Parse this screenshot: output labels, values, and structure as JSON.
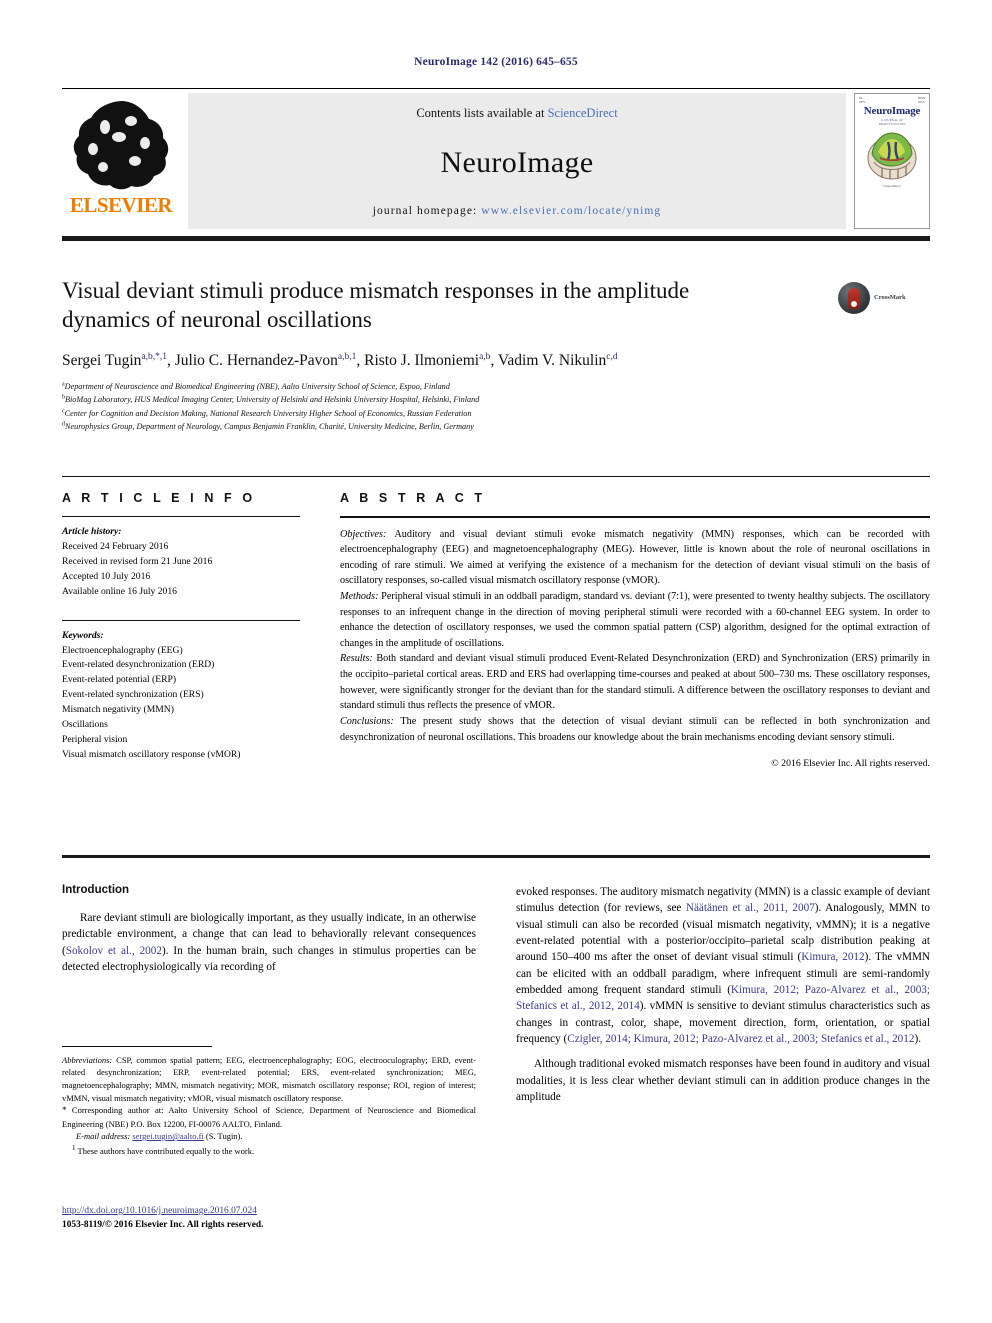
{
  "running_head": "NeuroImage 142 (2016) 645–655",
  "masthead": {
    "contents_prefix": "Contents lists available at ",
    "sciencedirect": "ScienceDirect",
    "journal_name": "NeuroImage",
    "homepage_prefix": "journal homepage: ",
    "homepage_url": "www.elsevier.com/locate/ynimg",
    "publisher": "ELSEVIER",
    "cover": {
      "title": "NeuroImage",
      "subtitle": "A JOURNAL OF\nBRAIN FUNCTION",
      "footer": "ScienceDirect"
    }
  },
  "article": {
    "title": "Visual deviant stimuli produce mismatch responses in the amplitude dynamics of neuronal oscillations",
    "crossmark_label": "CrossMark",
    "authors": [
      {
        "name": "Sergei Tugin",
        "sup": "a,b,*,1"
      },
      {
        "name": "Julio C. Hernandez-Pavon",
        "sup": "a,b,1"
      },
      {
        "name": "Risto J. Ilmoniemi",
        "sup": "a,b"
      },
      {
        "name": "Vadim V. Nikulin",
        "sup": "c,d"
      }
    ],
    "affiliations": [
      {
        "mark": "a",
        "text": "Department of Neuroscience and Biomedical Engineering (NBE), Aalto University School of Science, Espoo, Finland"
      },
      {
        "mark": "b",
        "text": "BioMag Laboratory, HUS Medical Imaging Center, University of Helsinki and Helsinki University Hospital, Helsinki, Finland"
      },
      {
        "mark": "c",
        "text": "Center for Cognition and Decision Making, National Research University Higher School of Economics, Russian Federation"
      },
      {
        "mark": "d",
        "text": "Neurophysics Group, Department of Neurology, Campus Benjamin Franklin, Charité, University Medicine, Berlin, Germany"
      }
    ]
  },
  "article_info": {
    "heading": "A R T I C L E   I N F O",
    "history_label": "Article history:",
    "history": [
      "Received 24 February 2016",
      "Received in revised form 21 June 2016",
      "Accepted 10 July 2016",
      "Available online 16 July 2016"
    ],
    "keywords_label": "Keywords:",
    "keywords": [
      "Electroencephalography (EEG)",
      "Event-related desynchronization (ERD)",
      "Event-related potential (ERP)",
      "Event-related synchronization (ERS)",
      "Mismatch negativity (MMN)",
      "Oscillations",
      "Peripheral vision",
      "Visual mismatch oscillatory response (vMOR)"
    ]
  },
  "abstract": {
    "heading": "A B S T R A C T",
    "objectives_label": "Objectives:",
    "objectives": " Auditory and visual deviant stimuli evoke mismatch negativity (MMN) responses, which can be recorded with electroencephalography (EEG) and magnetoencephalography (MEG). However, little is known about the role of neuronal oscillations in encoding of rare stimuli. We aimed at verifying the existence of a mechanism for the detection of deviant visual stimuli on the basis of oscillatory responses, so-called visual mismatch oscillatory response (vMOR).",
    "methods_label": "Methods:",
    "methods": " Peripheral visual stimuli in an oddball paradigm, standard vs. deviant (7:1), were presented to twenty healthy subjects. The oscillatory responses to an infrequent change in the direction of moving peripheral stimuli were recorded with a 60-channel EEG system. In order to enhance the detection of oscillatory responses, we used the common spatial pattern (CSP) algorithm, designed for the optimal extraction of changes in the amplitude of oscillations.",
    "results_label": "Results:",
    "results": " Both standard and deviant visual stimuli produced Event-Related Desynchronization (ERD) and Synchronization (ERS) primarily in the occipito–parietal cortical areas. ERD and ERS had overlapping time-courses and peaked at about 500–730 ms. These oscillatory responses, however, were significantly stronger for the deviant than for the standard stimuli. A difference between the oscillatory responses to deviant and standard stimuli thus reflects the presence of vMOR.",
    "conclusions_label": "Conclusions:",
    "conclusions": " The present study shows that the detection of visual deviant stimuli can be reflected in both synchronization and desynchronization of neuronal oscillations. This broadens our knowledge about the brain mechanisms encoding deviant sensory stimuli.",
    "copyright": "© 2016 Elsevier Inc. All rights reserved."
  },
  "introduction": {
    "heading": "Introduction",
    "left_paragraph_1_a": "Rare deviant stimuli are biologically important, as they usually indicate, in an otherwise predictable environment, a change that can lead to behaviorally relevant consequences (",
    "left_ref_1": "Sokolov et al., 2002",
    "left_paragraph_1_b": "). In the human brain, such changes in stimulus properties can be detected electrophysiologically via recording of",
    "right_paragraph_1_a": "evoked responses. The auditory mismatch negativity (MMN) is a classic example of deviant stimulus detection (for reviews, see ",
    "right_ref_1": "Näätänen et al., 2011, 2007",
    "right_paragraph_1_b": "). Analogously, MMN to visual stimuli can also be recorded (visual mismatch negativity, vMMN); it is a negative event-related potential with a posterior/occipito–parietal scalp distribution peaking at around 150–400  ms after the onset of deviant visual stimuli (",
    "right_ref_2": "Kimura, 2012",
    "right_paragraph_1_c": "). The vMMN can be elicited with an oddball paradigm, where infrequent stimuli are semi-randomly embedded among frequent standard stimuli (",
    "right_ref_3": "Kimura, 2012; Pazo-Alvarez et al., 2003; Stefanics et al., 2012, 2014",
    "right_paragraph_1_d": "). vMMN is sensitive to deviant stimulus characteristics such as changes in contrast, color, shape, movement direction, form, orientation, or spatial frequency (",
    "right_ref_4": "Czigler, 2014; Kimura, 2012; Pazo-Alvarez et al., 2003; Stefanics et al., 2012",
    "right_paragraph_1_e": ").",
    "right_paragraph_2": "Although traditional evoked mismatch responses have been found in auditory and visual modalities, it is less clear whether deviant stimuli can in addition produce changes in the amplitude"
  },
  "footnotes": {
    "abbrev_label": "Abbreviations:",
    "abbrev_text": " CSP, common spatial pattern; EEG, electroencephalography; EOG, electrooculography; ERD, event-related desynchronization; ERP, event-related potential; ERS, event-related synchronization; MEG, magnetoencephalography; MMN, mismatch negativity; MOR, mismatch oscillatory response; ROI, region of interest; vMMN, visual mismatch negativity; vMOR, visual mismatch oscillatory response.",
    "corresponding_mark": "*",
    "corresponding_text": " Corresponding author at: Aalto University School of Science, Department of Neuroscience and Biomedical Engineering (NBE) P.O. Box 12200, FI-00076 AALTO, Finland.",
    "email_label": "E-mail address:",
    "email": "sergei.tugin@aalto.fi",
    "email_suffix": " (S. Tugin).",
    "equal_mark": "1",
    "equal_text": " These authors have contributed equally to the work."
  },
  "footer": {
    "doi": "http://dx.doi.org/10.1016/j.neuroimage.2016.07.024",
    "issn_line": "1053-8119/© 2016 Elsevier Inc. All rights reserved."
  },
  "colors": {
    "link": "#3a3a8c",
    "elsevier_orange": "#ef7d00",
    "masthead_bg": "#ebebeb",
    "running_head": "#2b2a6b"
  }
}
